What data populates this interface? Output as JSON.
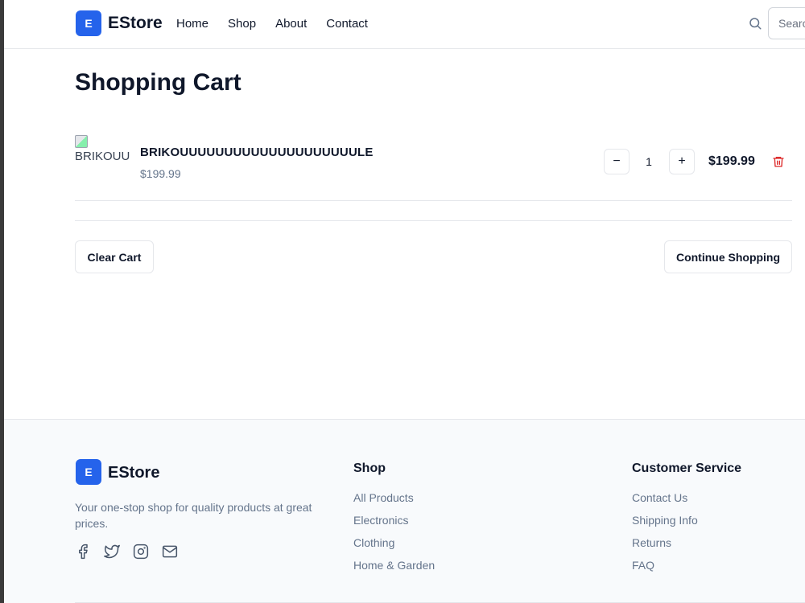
{
  "header": {
    "logo_letter": "E",
    "brand": "EStore",
    "nav": [
      "Home",
      "Shop",
      "About",
      "Contact"
    ],
    "search_placeholder": "Search"
  },
  "cart": {
    "title": "Shopping Cart",
    "items": [
      {
        "image_alt": "BRIKOUU",
        "name": "BRIKOUUUUUUUUUUUUUUUUUUUULE",
        "price": "$199.99",
        "quantity": "1",
        "line_total": "$199.99",
        "minus_label": "−",
        "plus_label": "+"
      }
    ],
    "clear_label": "Clear Cart",
    "continue_label": "Continue Shopping"
  },
  "footer": {
    "logo_letter": "E",
    "brand": "EStore",
    "tagline": "Your one-stop shop for quality products at great prices.",
    "social": [
      "facebook-icon",
      "twitter-icon",
      "instagram-icon",
      "mail-icon"
    ],
    "shop": {
      "heading": "Shop",
      "links": [
        "All Products",
        "Electronics",
        "Clothing",
        "Home & Garden"
      ]
    },
    "service": {
      "heading": "Customer Service",
      "links": [
        "Contact Us",
        "Shipping Info",
        "Returns",
        "FAQ"
      ]
    }
  },
  "colors": {
    "brand": "#2563eb",
    "delete": "#dc2626",
    "muted": "#64748b"
  }
}
